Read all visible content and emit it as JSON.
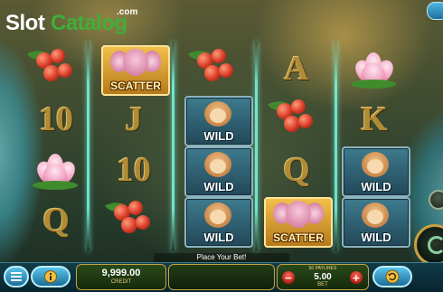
{
  "logo": {
    "slot": "Slot",
    "catalog": "Catalog",
    "com": ".com"
  },
  "reels": [
    [
      "cherries",
      "10",
      "lotus",
      "Q"
    ],
    [
      "scatter",
      "J",
      "10",
      "cherries"
    ],
    [
      "cherries",
      "wild",
      "wild",
      "wild"
    ],
    [
      "A",
      "cherries",
      "Q",
      "scatter"
    ],
    [
      "lotus",
      "K",
      "wild",
      "wild"
    ]
  ],
  "symbols": {
    "wild_label": "WILD",
    "scatter_label": "SCATTER"
  },
  "message": "Place Your Bet!",
  "credit": {
    "value": "9,999.00",
    "label": "CREDIT"
  },
  "bet": {
    "ways": "50 PAYLINES",
    "value": "5.00",
    "label": "BET",
    "minus": "−",
    "plus": "+"
  },
  "buttons": {
    "menu_icon": "menu-icon",
    "info_icon": "info-icon",
    "autoplay_icon": "autoplay-icon",
    "spin_icon": "spin-icon"
  },
  "colors": {
    "accent": "#c8a040",
    "rank_gold": "#b08c36",
    "wild_teal": "#3e7a8e",
    "scatter_gold": "#f1c04a"
  }
}
